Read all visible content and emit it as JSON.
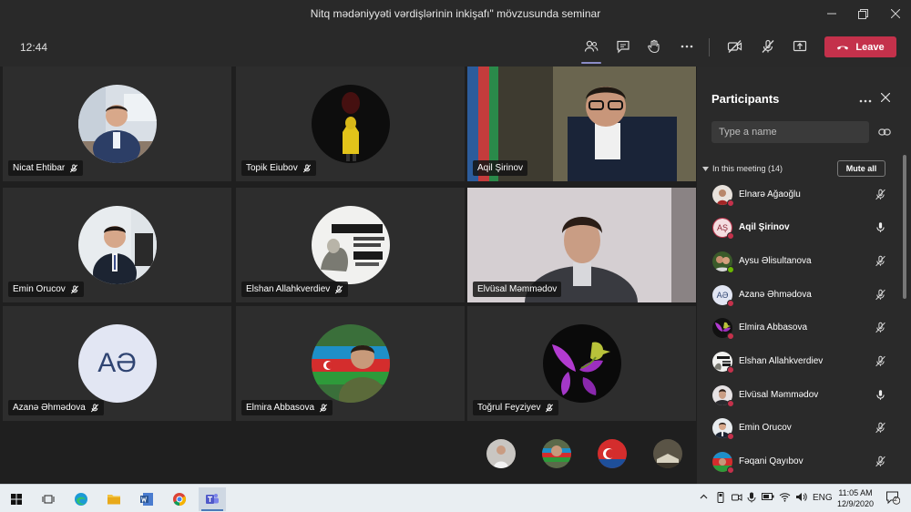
{
  "window": {
    "title": "Nitq mədəniyyəti vərdişlərinin inkişafı\" mövzusunda seminar",
    "controls": [
      "minimize",
      "restore",
      "close"
    ]
  },
  "toolbar": {
    "timer": "12:44",
    "leave_label": "Leave"
  },
  "video_tiles": [
    {
      "name": "Nicat Ehtibar"
    },
    {
      "name": "Topik Eiubov"
    },
    {
      "name": "Aqil Şirinov"
    },
    {
      "name": "Emin Orucov"
    },
    {
      "name": "Elshan Allahkverdiev"
    },
    {
      "name": "Elvüsal Məmmədov"
    },
    {
      "name": "Azanə Əhmədova",
      "initials": "AƏ"
    },
    {
      "name": "Elmira Abbasova"
    },
    {
      "name": "Toğrul Feyziyev"
    }
  ],
  "panel": {
    "title": "Participants",
    "search_placeholder": "Type a name",
    "section_label": "In this meeting (14)",
    "mute_all_label": "Mute all",
    "participants": [
      {
        "name": "Elnarə Ağaoğlu",
        "mic": "muted"
      },
      {
        "name": "Aqil Şirinov",
        "mic": "on",
        "initials": "AŞ"
      },
      {
        "name": "Aysu Əlisultanova",
        "mic": "muted"
      },
      {
        "name": "Azanə Əhmədova",
        "mic": "muted",
        "initials": "AƏ"
      },
      {
        "name": "Elmira Abbasova",
        "mic": "muted"
      },
      {
        "name": "Elshan Allahkverdiev",
        "mic": "muted"
      },
      {
        "name": "Elvüsal Məmmədov",
        "mic": "on"
      },
      {
        "name": "Emin Orucov",
        "mic": "muted"
      },
      {
        "name": "Fəqani Qayıbov",
        "mic": "muted"
      }
    ]
  },
  "taskbar": {
    "language": "ENG",
    "time": "11:05 AM",
    "date": "12/9/2020",
    "notification_count": "2"
  },
  "colors": {
    "leave": "#c4314b",
    "accent": "#8b8cc7",
    "status_busy": "#c4314b",
    "status_available": "#6bb700"
  }
}
